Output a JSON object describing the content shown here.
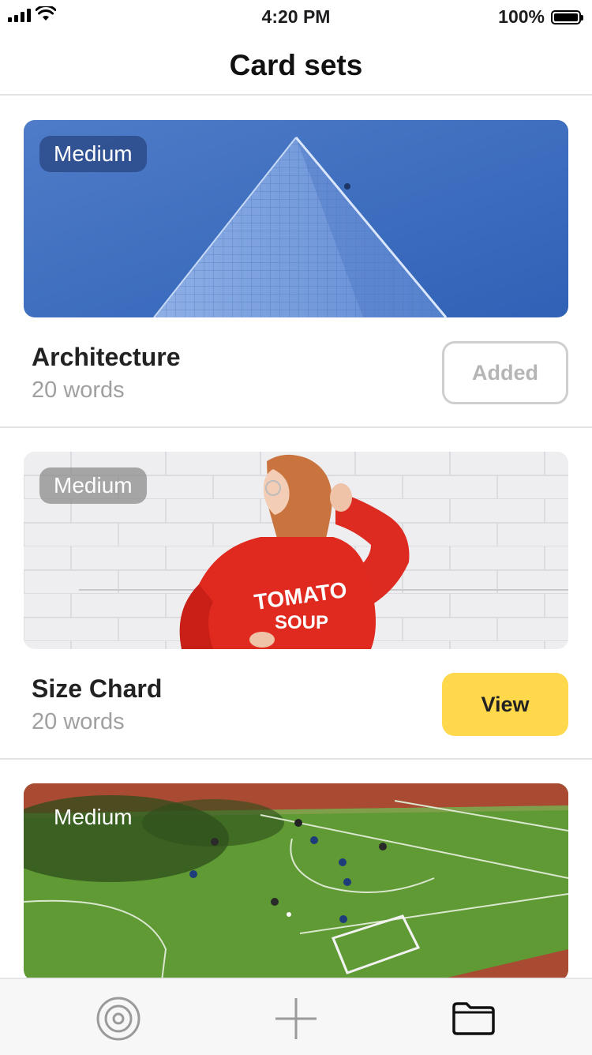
{
  "status_bar": {
    "time": "4:20 PM",
    "battery": "100%"
  },
  "nav": {
    "title": "Card sets"
  },
  "cards": [
    {
      "badge": "Medium",
      "title": "Architecture",
      "subtitle": "20 words",
      "button": "Added",
      "button_state": "added"
    },
    {
      "badge": "Medium",
      "title": "Size Chard",
      "subtitle": "20 words",
      "button": "View",
      "button_state": "view"
    },
    {
      "badge": "Medium"
    }
  ],
  "tab_bar": {
    "items": [
      {
        "icon": "target-icon"
      },
      {
        "icon": "plus-icon"
      },
      {
        "icon": "folder-icon"
      }
    ]
  },
  "colors": {
    "accent_yellow": "#ffd84c",
    "divider": "#e3e3e3",
    "muted_text": "#a0a0a0"
  }
}
